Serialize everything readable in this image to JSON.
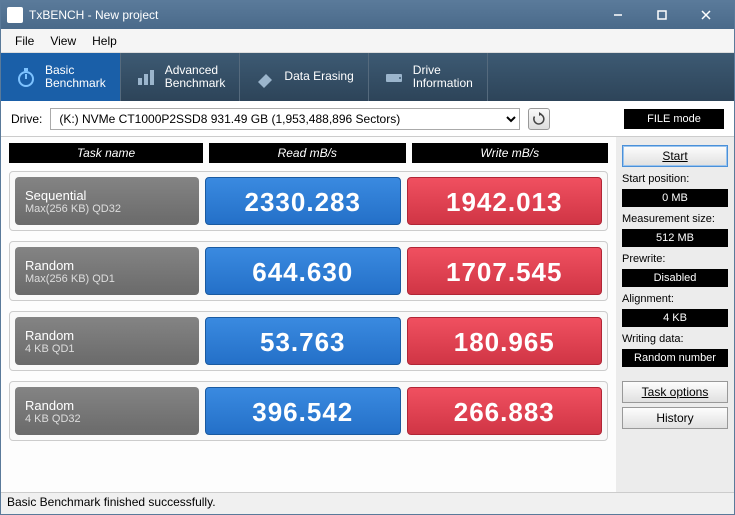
{
  "window": {
    "title": "TxBENCH - New project"
  },
  "menu": {
    "file": "File",
    "view": "View",
    "help": "Help"
  },
  "tabs": {
    "basic": "Basic\nBenchmark",
    "advanced": "Advanced\nBenchmark",
    "erasing": "Data Erasing",
    "info": "Drive\nInformation"
  },
  "drive": {
    "label": "Drive:",
    "selected": "(K:) NVMe CT1000P2SSD8  931.49 GB (1,953,488,896 Sectors)",
    "filemode": "FILE mode"
  },
  "headers": {
    "task": "Task name",
    "read": "Read mB/s",
    "write": "Write mB/s"
  },
  "rows": [
    {
      "t1": "Sequential",
      "t2": "Max(256 KB) QD32",
      "read": "2330.283",
      "write": "1942.013"
    },
    {
      "t1": "Random",
      "t2": "Max(256 KB) QD1",
      "read": "644.630",
      "write": "1707.545"
    },
    {
      "t1": "Random",
      "t2": "4 KB QD1",
      "read": "53.763",
      "write": "180.965"
    },
    {
      "t1": "Random",
      "t2": "4 KB QD32",
      "read": "396.542",
      "write": "266.883"
    }
  ],
  "side": {
    "start": "Start",
    "startpos_lbl": "Start position:",
    "startpos": "0 MB",
    "meassize_lbl": "Measurement size:",
    "meassize": "512 MB",
    "prewrite_lbl": "Prewrite:",
    "prewrite": "Disabled",
    "align_lbl": "Alignment:",
    "align": "4 KB",
    "wdata_lbl": "Writing data:",
    "wdata": "Random number",
    "taskopt": "Task options",
    "history": "History"
  },
  "status": "Basic Benchmark finished successfully."
}
